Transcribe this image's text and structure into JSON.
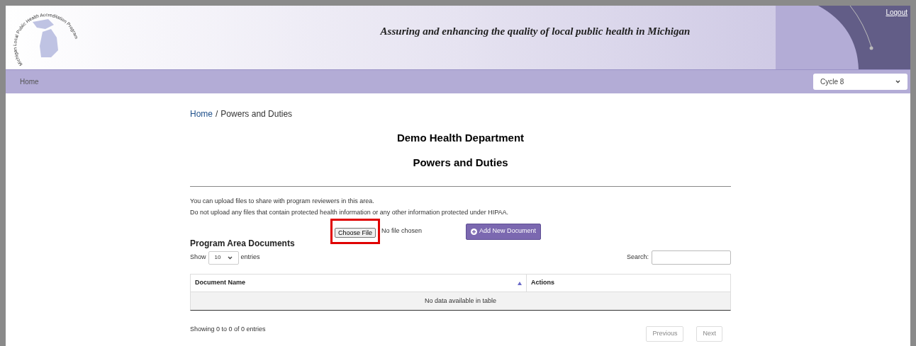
{
  "header": {
    "logo_text": "Michigan Local Public Health Accreditation Program",
    "tagline": "Assuring and enhancing the quality of local public health in Michigan",
    "logout": "Logout"
  },
  "nav": {
    "items": [
      {
        "label": "Home",
        "selected": false
      }
    ],
    "cycle_select": {
      "value": "Cycle 8"
    }
  },
  "breadcrumb_separator": "/",
  "breadcrumb": [
    {
      "label": "Home",
      "kind": "link"
    },
    {
      "label": "Powers and Duties",
      "kind": "current"
    }
  ],
  "department": "Demo Health Department",
  "page_title": "Powers and Duties",
  "notes": [
    "You can upload files to share with program reviewers in this area.",
    "Do not upload any files that contain protected health information or any other information protected under HIPAA."
  ],
  "upload": {
    "button": "Choose File",
    "status": "No file chosen",
    "highlighted": true,
    "add_button": "Add New Document"
  },
  "documents": {
    "title": "Program Area Documents",
    "show_label": "Show",
    "page_size": "10",
    "entries_label": "entries",
    "search_label": "Search:",
    "columns": [
      {
        "label": "Document Name",
        "sorted": true
      },
      {
        "label": "Actions",
        "sorted": false
      }
    ],
    "empty_message": "No data available in table",
    "info": "Showing 0 to 0 of 0 entries",
    "pager": [
      {
        "label": "Previous",
        "disabled": true
      },
      {
        "label": "Next",
        "disabled": true
      }
    ]
  }
}
